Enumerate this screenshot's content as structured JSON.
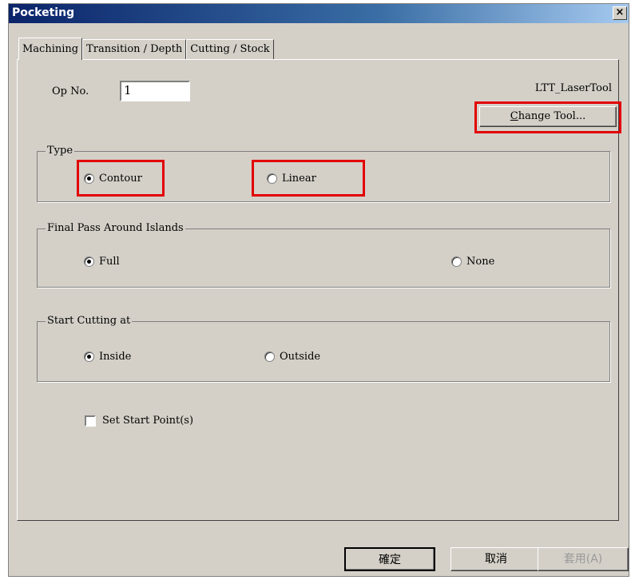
{
  "window": {
    "title": "Pocketing",
    "close_glyph": "×"
  },
  "tabs": [
    {
      "label": "Machining",
      "active": true
    },
    {
      "label": "Transition / Depth",
      "active": false
    },
    {
      "label": "Cutting / Stock",
      "active": false
    }
  ],
  "op": {
    "label": "Op No.",
    "value": "1"
  },
  "tool": {
    "name": "LTT_LaserTool",
    "change_label": "Change Tool...",
    "mnemonic": "C"
  },
  "type_group": {
    "legend": "Type",
    "options": [
      {
        "label": "Contour",
        "selected": true
      },
      {
        "label": "Linear",
        "selected": false
      }
    ]
  },
  "final_pass_group": {
    "legend": "Final Pass Around Islands",
    "options": [
      {
        "label": "Full",
        "selected": true
      },
      {
        "label": "None",
        "selected": false
      }
    ]
  },
  "start_cutting_group": {
    "legend": "Start Cutting at",
    "options": [
      {
        "label": "Inside",
        "selected": true
      },
      {
        "label": "Outside",
        "selected": false
      }
    ]
  },
  "set_start_point": {
    "label": "Set Start Point(s)",
    "checked": false
  },
  "buttons": {
    "ok": "確定",
    "cancel": "取消",
    "apply": "套用(A)"
  },
  "colors": {
    "dialog_bg": "#d4d0c8",
    "highlight": "#e20000",
    "titlebar": "#0a246a"
  }
}
